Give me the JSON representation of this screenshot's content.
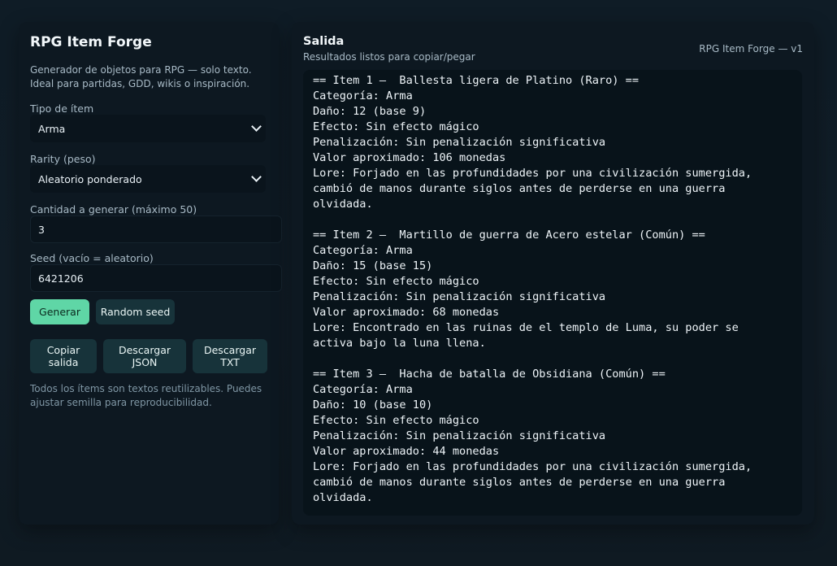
{
  "sidebar": {
    "title": "RPG Item Forge",
    "description": "Generador de objetos para RPG — solo texto. Ideal para partidas, GDD, wikis o inspiración.",
    "item_type_label": "Tipo de ítem",
    "item_type_value": "Arma",
    "rarity_label": "Rarity (peso)",
    "rarity_value": "Aleatorio ponderado",
    "quantity_label": "Cantidad a generar (máximo 50)",
    "quantity_value": "3",
    "seed_label": "Seed (vacío = aleatorio)",
    "seed_value": "6421206",
    "generate_label": "Generar",
    "random_seed_label": "Random seed",
    "copy_line1": "Copiar",
    "copy_line2": "salida",
    "json_line1": "Descargar",
    "json_line2": "JSON",
    "txt_line1": "Descargar",
    "txt_line2": "TXT",
    "footnote": "Todos los ítems son textos reutilizables. Puedes ajustar semilla para reproducibilidad."
  },
  "output": {
    "title": "Salida",
    "subtitle": "Resultados listos para copiar/pegar",
    "version": "RPG Item Forge — v1",
    "lines": [
      "== Item 1 —  Ballesta ligera de Platino (Raro) ==",
      "Categoría: Arma",
      "Daño: 12 (base 9)",
      "Efecto: Sin efecto mágico",
      "Penalización: Sin penalización significativa",
      "Valor aproximado: 106 monedas",
      "Lore: Forjado en las profundidades por una civilización sumergida,",
      "cambió de manos durante siglos antes de perderse en una guerra",
      "olvidada.",
      "",
      "== Item 2 —  Martillo de guerra de Acero estelar (Común) ==",
      "Categoría: Arma",
      "Daño: 15 (base 15)",
      "Efecto: Sin efecto mágico",
      "Penalización: Sin penalización significativa",
      "Valor aproximado: 68 monedas",
      "Lore: Encontrado en las ruinas de el templo de Luma, su poder se",
      "activa bajo la luna llena.",
      "",
      "== Item 3 —  Hacha de batalla de Obsidiana (Común) ==",
      "Categoría: Arma",
      "Daño: 10 (base 10)",
      "Efecto: Sin efecto mágico",
      "Penalización: Sin penalización significativa",
      "Valor aproximado: 44 monedas",
      "Lore: Forjado en las profundidades por una civilización sumergida,",
      "cambió de manos durante siglos antes de perderse en una guerra",
      "olvidada."
    ]
  }
}
